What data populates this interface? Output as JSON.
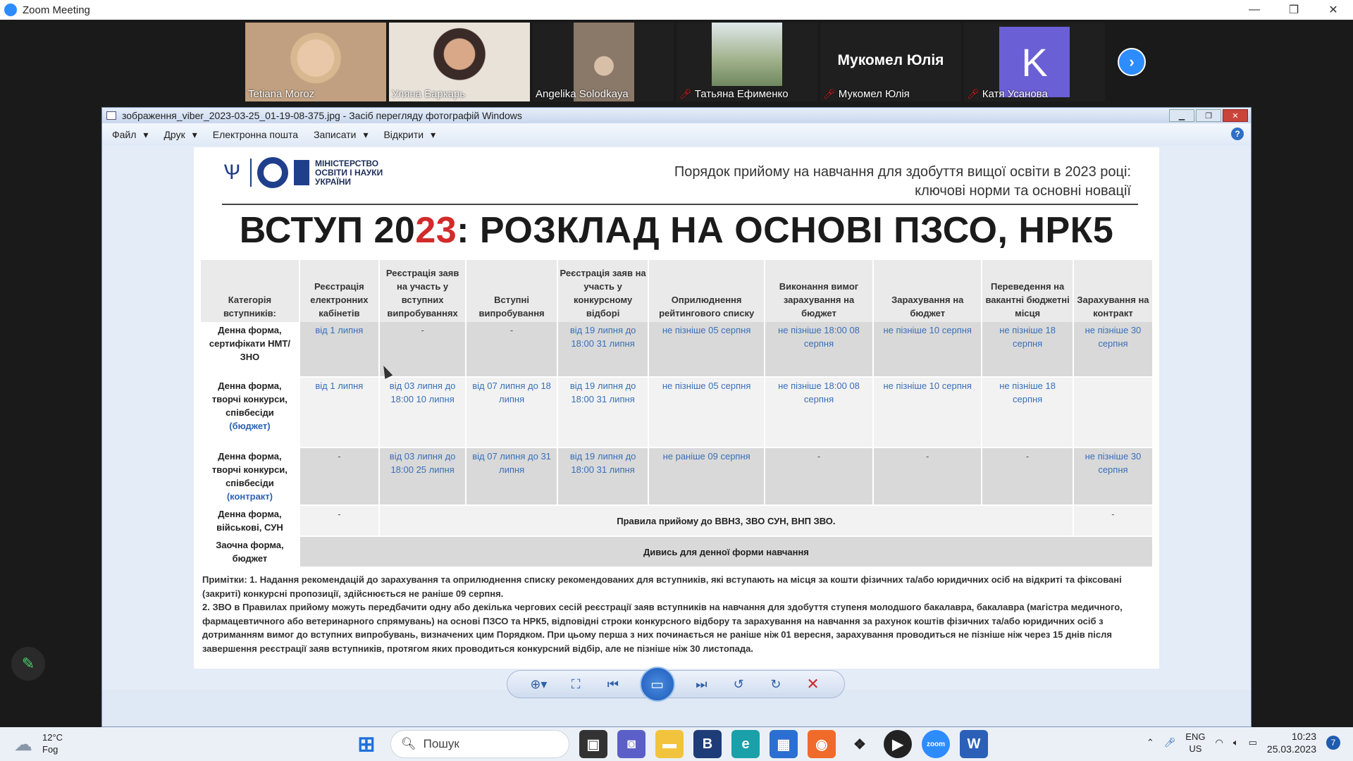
{
  "zoom": {
    "title": "Zoom Meeting",
    "minimize": "—",
    "restore": "❐",
    "close": "✕"
  },
  "participants": [
    {
      "name": "Tetiana Moroz",
      "muted": false,
      "active": false,
      "bg": "#b89a7a"
    },
    {
      "name": "Уляна Баркарь",
      "muted": false,
      "active": true,
      "bg": "#b7a99c"
    },
    {
      "name": "Angelika Solodkaya",
      "muted": false,
      "active": false,
      "bg": "#a39380"
    },
    {
      "name": "Татьяна Ефименко",
      "muted": true,
      "active": false,
      "bg": "#8fa27a"
    },
    {
      "name": "Мукомел Юлія",
      "muted": true,
      "active": false,
      "display_name": "Мукомел Юлія"
    },
    {
      "name": "Катя Усанова",
      "muted": true,
      "active": false,
      "avatar_letter": "K"
    }
  ],
  "next_icon": "chevron-right-icon",
  "viewer": {
    "title": "зображення_viber_2023-03-25_01-19-08-375.jpg - Засіб перегляду фотографій Windows",
    "menu": [
      "Файл",
      "Друк",
      "Електронна пошта",
      "Записати",
      "Відкрити"
    ],
    "help": "?"
  },
  "doc": {
    "ministry": "МІНІСТЕРСТВО ОСВІТИ І НАУКИ УКРАЇНИ",
    "subtitle_line1": "Порядок прийому на навчання для здобуття вищої освіти в 2023 році:",
    "subtitle_line2": "ключові норми та основні новації",
    "headline_a": "ВСТУП 20",
    "headline_b": "23",
    "headline_c": ": РОЗКЛАД НА ОСНОВІ ПЗСО, НРК5",
    "headers": [
      "Категорія вступників:",
      "Реєстрація електронних кабінетів",
      "Реєстрація заяв на участь у вступних випробуваннях",
      "Вступні випробування",
      "Реєстрація заяв на участь у конкурсному відборі",
      "Оприлюднення рейтингового списку",
      "Виконання вимог зарахування на бюджет",
      "Зарахування на бюджет",
      "Переведення на вакантні бюджетні місця",
      "Зарахування на контракт"
    ],
    "rows": [
      {
        "cat": "Денна форма, сертифікати НМТ/ЗНО",
        "cat_extra": "",
        "cells": [
          "від 1 липня",
          "-",
          "-",
          "від 19 липня до 18:00 31 липня",
          "не пізніше 05 серпня",
          "не пізніше 18:00 08 серпня",
          "не пізніше 10 серпня",
          "не пізніше 18 серпня",
          "не пізніше 30 серпня"
        ]
      },
      {
        "cat": "Денна форма, творчі конкурси, співбесіди",
        "cat_extra": "(бюджет)",
        "cells": [
          "від 1 липня",
          "від 03 липня до 18:00 10 липня",
          "від 07 липня до 18 липня",
          "від 19 липня до 18:00 31 липня",
          "не пізніше 05 серпня",
          "не пізніше 18:00 08 серпня",
          "не пізніше 10 серпня",
          "не пізніше 18 серпня",
          ""
        ]
      },
      {
        "cat": "Денна форма, творчі конкурси, співбесіди",
        "cat_extra": "(контракт)",
        "cells": [
          "-",
          "від 03 липня до 18:00 25 липня",
          "від 07 липня до 31 липня",
          "від 19 липня до 18:00 31 липня",
          "не раніше 09 серпня",
          "-",
          "-",
          "-",
          "не пізніше 30 серпня"
        ]
      }
    ],
    "row_military": {
      "cat": "Денна форма, військові, СУН",
      "first": "-",
      "span": "Правила прийому до ВВНЗ, ЗВО СУН, ВНП ЗВО.",
      "last": "-"
    },
    "row_extramural": {
      "cat": "Заочна форма, бюджет",
      "span": "Дивись для денної форми навчання"
    },
    "note1": "Примітки: 1. Надання рекомендацій до зарахування та оприлюднення списку рекомендованих для вступників, які вступають на місця за кошти фізичних та/або юридичних осіб на відкриті та фіксовані (закриті) конкурсні пропозиції, здійснюється не раніше 09 серпня.",
    "note2": "2. ЗВО в Правилах прийому можуть передбачити одну або декілька чергових сесій реєстрації заяв вступників на навчання для здобуття ступеня молодшого бакалавра, бакалавра (магістра медичного, фармацевтичного або ветеринарного спрямувань) на основі ПЗСО та НРК5, відповідні строки конкурсного відбору та зарахування на навчання за рахунок коштів фізичних та/або юридичних осіб з дотриманням вимог до вступних випробувань, визначених цим Порядком. При цьому перша з них починається не раніше ніж 01 вересня, зарахування проводиться не пізніше ніж через 15 днів після завершення реєстрації заяв вступників, протягом яких проводиться конкурсний відбір, але не пізніше ніж 30 листопада."
  },
  "taskbar": {
    "temp": "12°C",
    "weather": "Fog",
    "search_placeholder": "Пошук",
    "lang1": "ENG",
    "lang2": "US",
    "time": "10:23",
    "date": "25.03.2023",
    "notifications": "7"
  },
  "colors": {
    "zoom_blue": "#2d8cff",
    "active_speaker": "#9fd35f",
    "doc_red": "#d22b2b",
    "doc_blue": "#3a6fb8"
  }
}
